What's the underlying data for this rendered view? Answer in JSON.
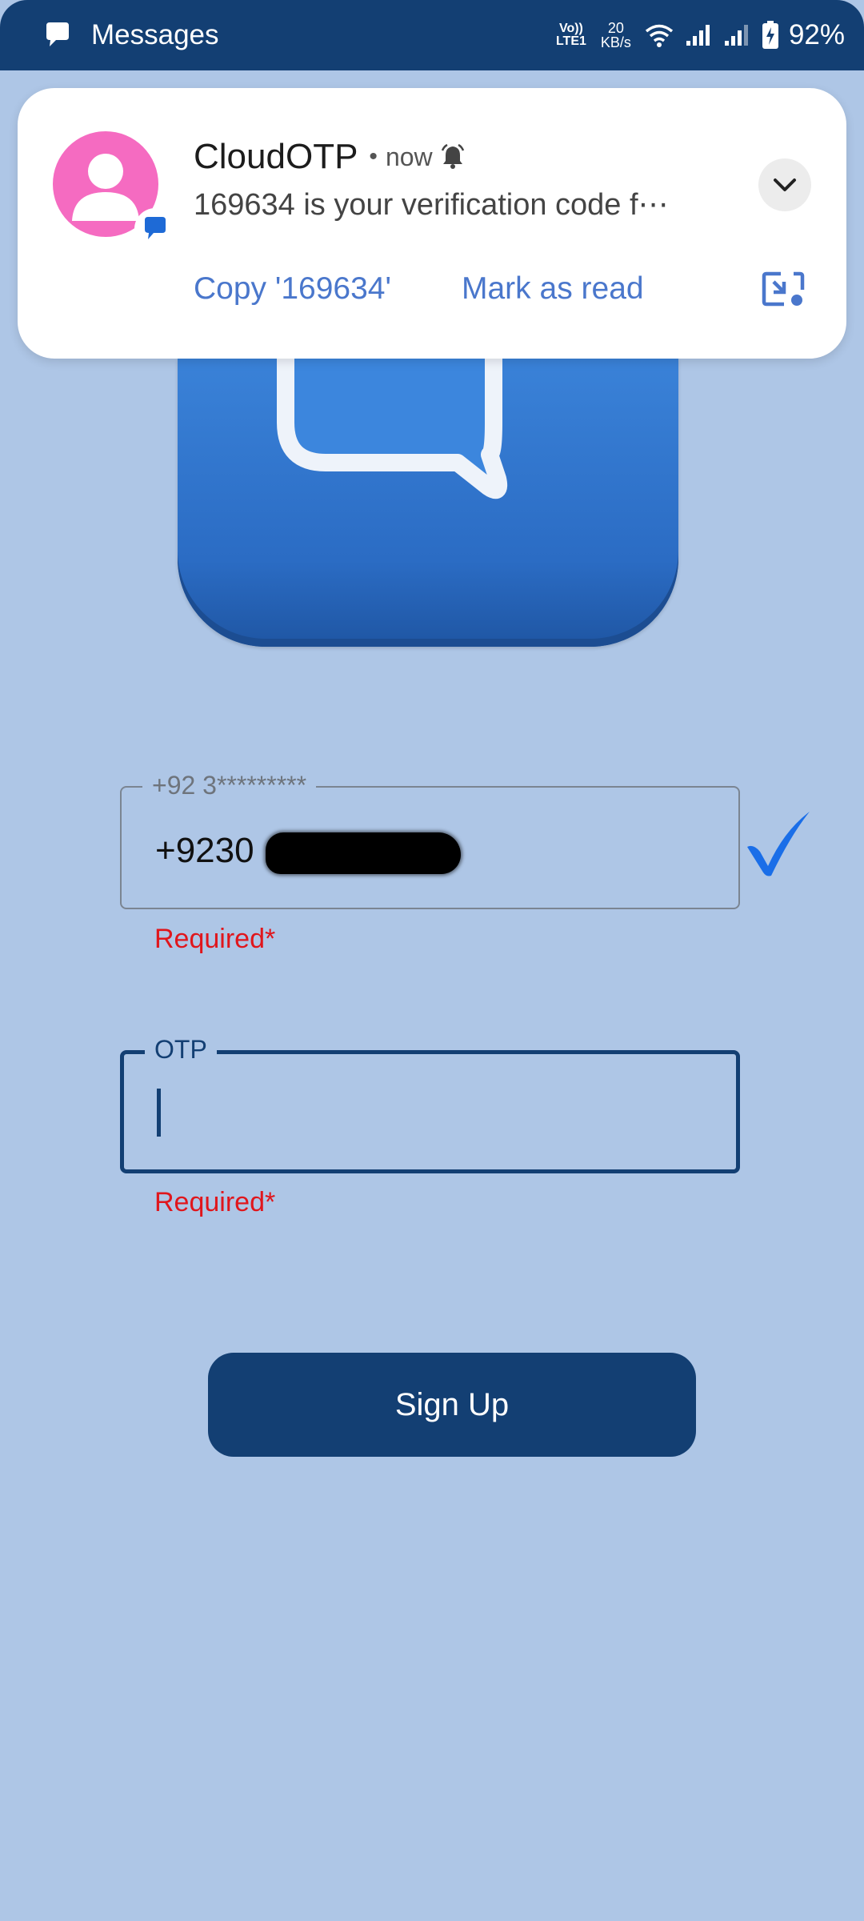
{
  "status_bar": {
    "app_name": "Messages",
    "volte_top": "Vo))",
    "volte_bottom": "LTE1",
    "net_speed_value": "20",
    "net_speed_unit": "KB/s",
    "battery_percent": "92%"
  },
  "notification": {
    "sender": "CloudOTP",
    "separator": "•",
    "time": "now",
    "body": "169634 is your verification code f⋯",
    "actions": {
      "copy_label": "Copy '169634'",
      "mark_read_label": "Mark as read"
    },
    "icons": [
      "contact-avatar-icon",
      "messages-badge-icon",
      "bell-icon",
      "chevron-down-icon",
      "picture-in-picture-icon"
    ]
  },
  "form": {
    "phone": {
      "label": "+92 3*********",
      "value": "+9230",
      "error": "Required*",
      "status_icon": "checkmark-icon"
    },
    "otp": {
      "label": "OTP",
      "value": "",
      "error": "Required*"
    },
    "submit_label": "Sign Up"
  },
  "colors": {
    "background": "#aec6e6",
    "primary": "#133f73",
    "accent": "#4a77cc",
    "error": "#e0161c",
    "check": "#1a6ee8",
    "avatar": "#f56bc1"
  }
}
